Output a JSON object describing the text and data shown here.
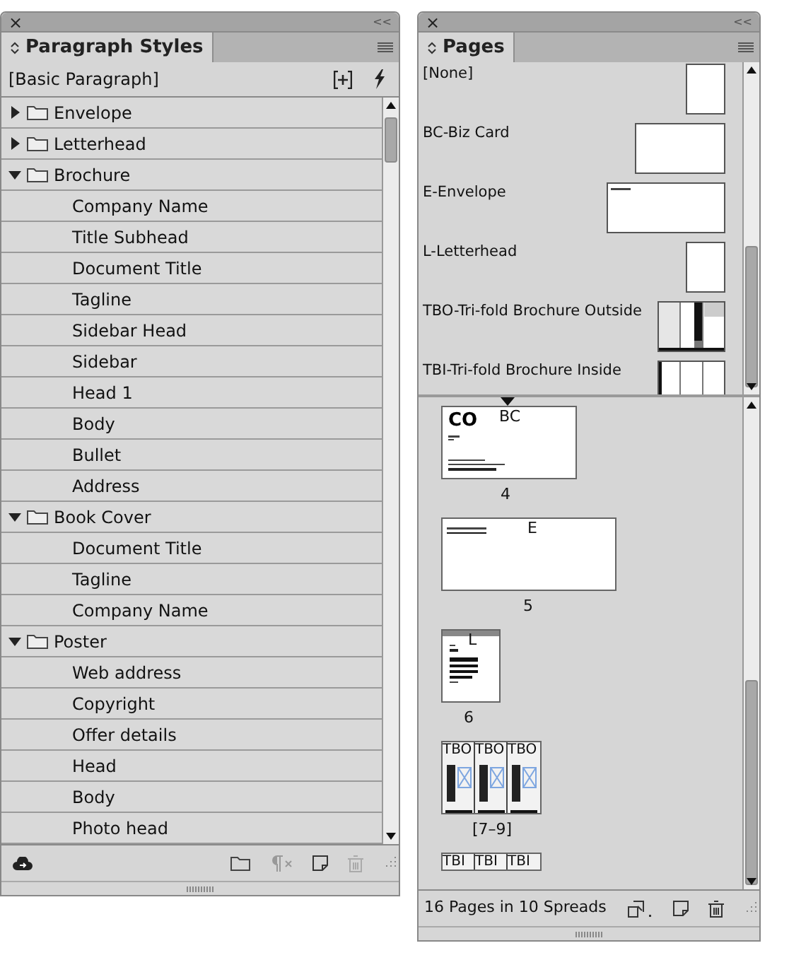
{
  "styles_panel": {
    "tab": "Paragraph Styles",
    "close": "×",
    "collapse": "<<",
    "basic": "[Basic Paragraph]",
    "groups": [
      {
        "name": "Envelope",
        "expanded": false
      },
      {
        "name": "Letterhead",
        "expanded": false
      },
      {
        "name": "Brochure",
        "expanded": true,
        "children": [
          {
            "name": "Company Name"
          },
          {
            "name": "Title Subhead"
          },
          {
            "name": "Document Title"
          },
          {
            "name": "Tagline"
          },
          {
            "name": "Sidebar Head"
          },
          {
            "name": "Sidebar"
          },
          {
            "name": "Head 1"
          },
          {
            "name": "Body"
          },
          {
            "name": "Bullet"
          },
          {
            "name": "Address"
          }
        ]
      },
      {
        "name": "Book Cover",
        "expanded": true,
        "children": [
          {
            "name": "Document Title"
          },
          {
            "name": "Tagline"
          },
          {
            "name": "Company Name"
          }
        ]
      },
      {
        "name": "Poster",
        "expanded": true,
        "children": [
          {
            "name": "Web address"
          },
          {
            "name": "Copyright"
          },
          {
            "name": "Offer details"
          },
          {
            "name": "Head"
          },
          {
            "name": "Body"
          },
          {
            "name": "Photo head"
          }
        ]
      }
    ]
  },
  "pages_panel": {
    "tab": "Pages",
    "close": "×",
    "collapse": "<<",
    "masters": [
      {
        "name": "[None]",
        "kind": "portrait"
      },
      {
        "name": "BC-Biz Card",
        "kind": "card"
      },
      {
        "name": "E-Envelope",
        "kind": "envelope"
      },
      {
        "name": "L-Letterhead",
        "kind": "portrait"
      },
      {
        "name": "TBO-Tri-fold Brochure Outside",
        "kind": "trifold"
      },
      {
        "name": "TBI-Tri-fold Brochure Inside",
        "kind": "trifold-inside"
      }
    ],
    "spreads": [
      {
        "kind": "card",
        "masters": [
          "BC"
        ],
        "logo": "CO",
        "number": "4"
      },
      {
        "kind": "envelope",
        "masters": [
          "E"
        ],
        "number": "5"
      },
      {
        "kind": "letter",
        "masters": [
          "L"
        ],
        "number": "6"
      },
      {
        "kind": "trifold",
        "masters": [
          "TBO",
          "TBO",
          "TBO"
        ],
        "number": "[7–9]"
      },
      {
        "kind": "trifold-cut",
        "masters": [
          "TBI",
          "TBI",
          "TBI"
        ]
      }
    ],
    "status": "16 Pages in 10 Spreads"
  }
}
